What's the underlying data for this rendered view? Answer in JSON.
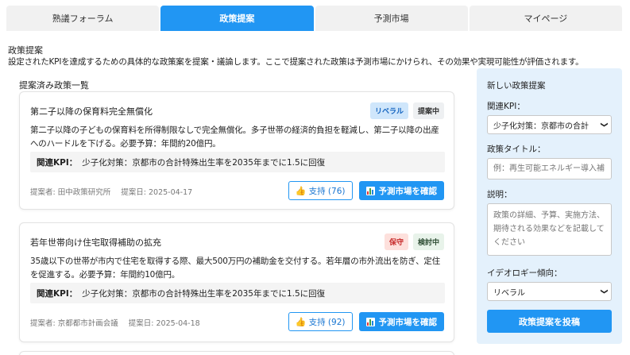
{
  "tabs": [
    {
      "label": "熟議フォーラム",
      "active": false
    },
    {
      "label": "政策提案",
      "active": true
    },
    {
      "label": "予測市場",
      "active": false
    },
    {
      "label": "マイページ",
      "active": false
    }
  ],
  "intro": {
    "title": "政策提案",
    "description": "設定されたKPIを達成するための具体的な政策案を提案・議論します。ここで提案された政策は予測市場にかけられ、その効果や実現可能性が評価されます。"
  },
  "list": {
    "title": "提案済み政策一覧",
    "kpi_label": "関連KPI：",
    "support_icon": "thumbs-up-icon",
    "market_icon": "bar-chart-icon",
    "market_label": "予測市場を確認",
    "items": [
      {
        "title": "第二子以降の保育料完全無償化",
        "ideology": "リベラル",
        "status": "提案中",
        "description": "第二子以降の子どもの保育料を所得制限なしで完全無償化。多子世帯の経済的負担を軽減し、第二子以降の出産へのハードルを下げる。必要予算：年間約20億円。",
        "kpi": "少子化対策：京都市の合計特殊出生率を2035年までに1.5に回復",
        "proposer": "提案者: 田中政策研究所",
        "date": "提案日: 2025-04-17",
        "support": "支持 (76)"
      },
      {
        "title": "若年世帯向け住宅取得補助の拡充",
        "ideology": "保守",
        "status": "検討中",
        "description": "35歳以下の世帯が市内で住宅を取得する際、最大500万円の補助金を交付する。若年層の市外流出を防ぎ、定住を促進する。必要予算：年間約10億円。",
        "kpi": "少子化対策：京都市の合計特殊出生率を2035年までに1.5に回復",
        "proposer": "提案者: 京都都市計画会議",
        "date": "提案日: 2025-04-18",
        "support": "支持 (92)"
      }
    ]
  },
  "form": {
    "title": "新しい政策提案",
    "kpi_label": "関連KPI：",
    "kpi_value": "少子化対策：京都市の合計",
    "policy_title_label": "政策タイトル：",
    "policy_title_placeholder": "例：再生可能エネルギー導入補",
    "description_label": "説明：",
    "description_placeholder": "政策の詳細、予算、実施方法、期待される効果などを記載してください",
    "ideology_label": "イデオロギー傾向：",
    "ideology_value": "リベラル",
    "submit_label": "政策提案を投稿"
  },
  "colors": {
    "accent": "#2196f3",
    "liberal_bg": "#cfe6fb",
    "conservative_bg": "#fde0dc"
  }
}
